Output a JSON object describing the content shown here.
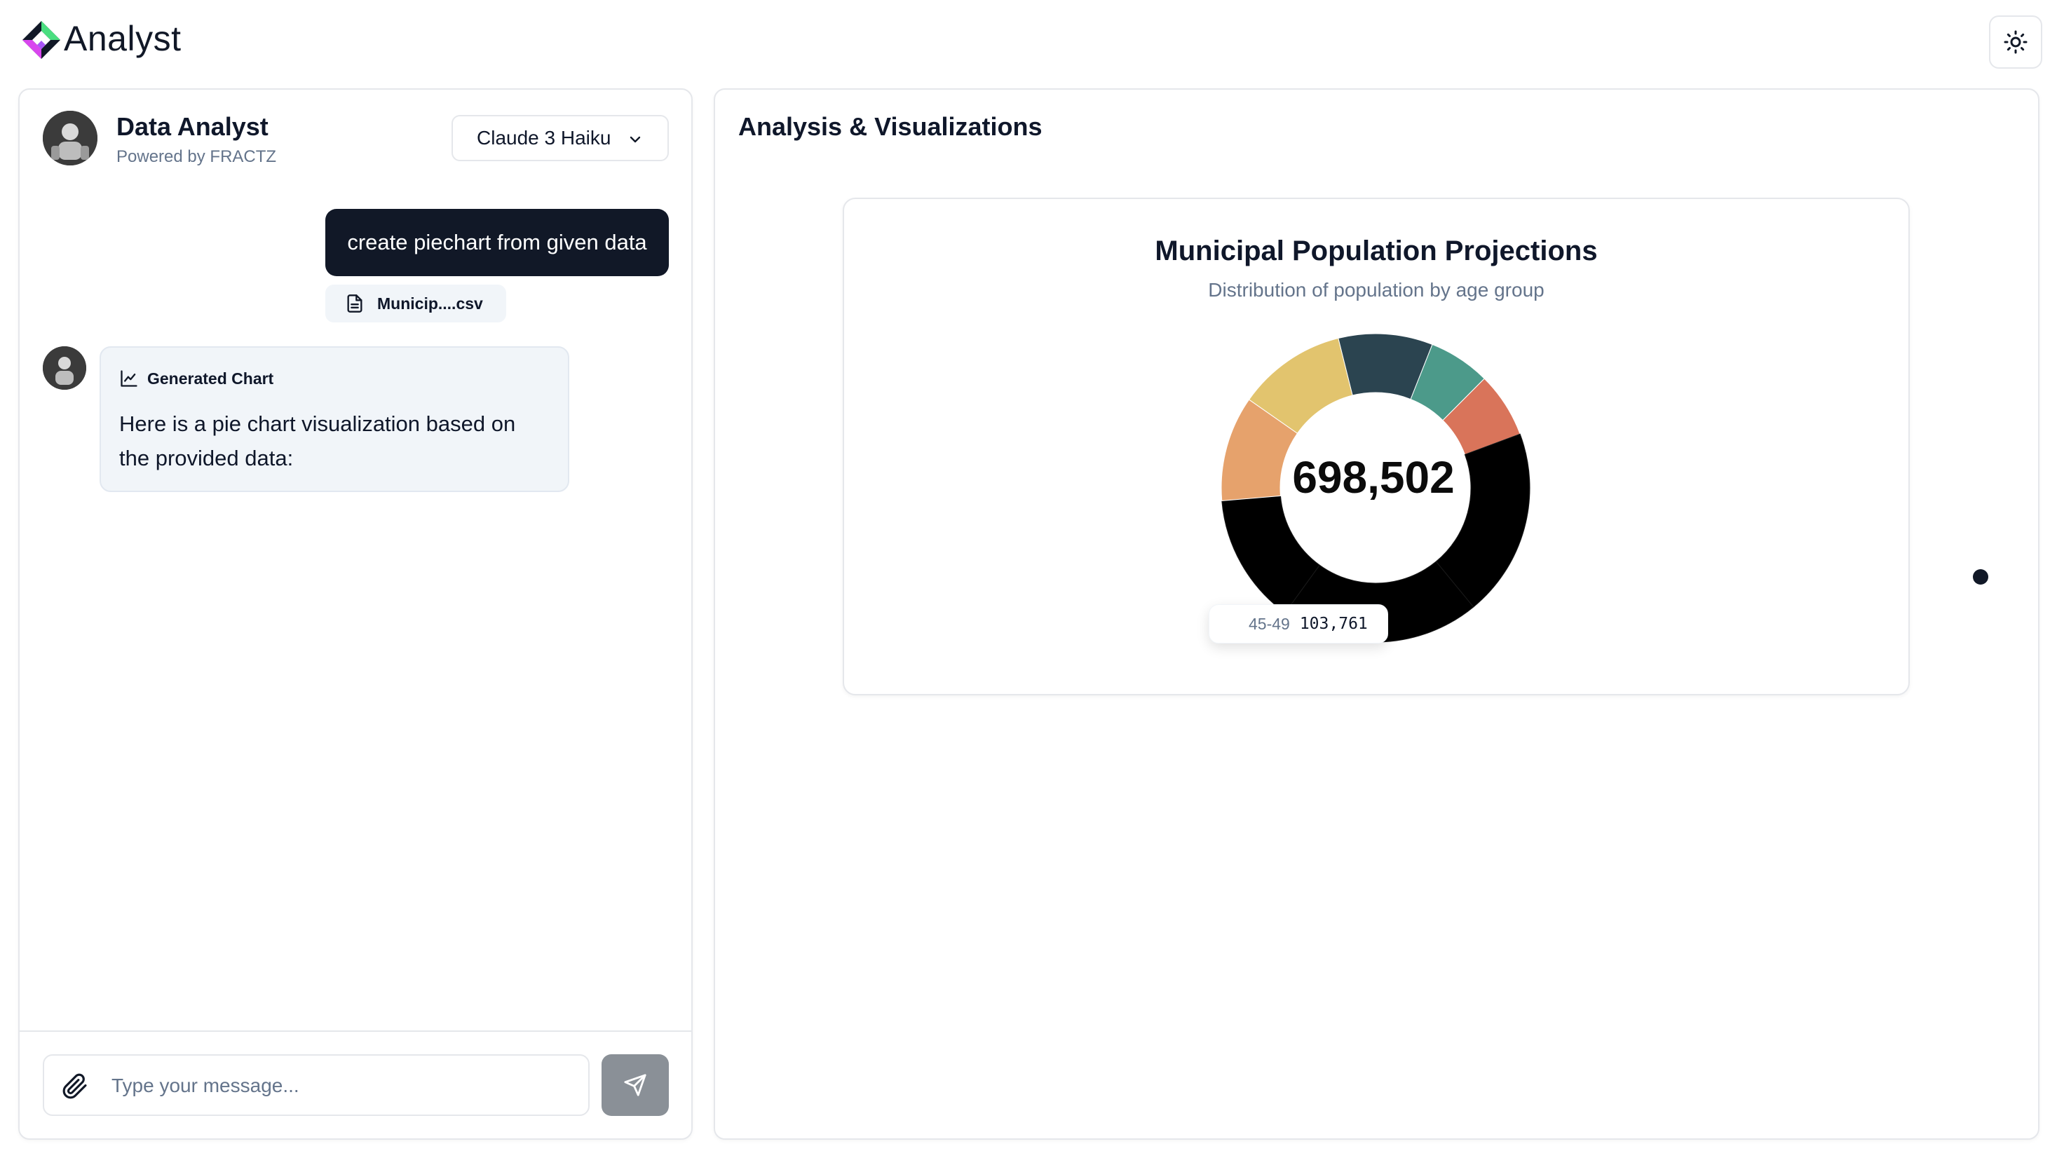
{
  "app": {
    "title": "Analyst"
  },
  "chat": {
    "agent_name": "Data Analyst",
    "agent_sub": "Powered by FRACTZ",
    "model": "Claude 3 Haiku",
    "user_message": "create piechart from given data",
    "attachment": "Municip....csv",
    "assistant_tag": "Generated Chart",
    "assistant_text": "Here is a pie chart visualization based on the provided data:",
    "input_placeholder": "Type your message..."
  },
  "viz": {
    "title": "Analysis & Visualizations"
  },
  "colors": {
    "accent": "#111827",
    "send_button": "#8a9097",
    "bubble_bg": "#f1f5f9"
  },
  "icons": {
    "logo": "diamond-logo-icon",
    "theme": "sun-icon",
    "dropdown": "chevron-down-icon",
    "file": "file-text-icon",
    "chart": "line-chart-icon",
    "attach": "paperclip-icon",
    "send": "send-icon"
  },
  "chart_data": {
    "type": "pie",
    "title": "Municipal Population Projections",
    "subtitle": "Distribution of population by age group",
    "total_label": "698,502",
    "tooltip": {
      "name": "45-49",
      "value": "103,761"
    },
    "slices": [
      {
        "value": 52000,
        "color": "#2b4450"
      },
      {
        "value": 34000,
        "color": "#4c9a8a"
      },
      {
        "value": 36000,
        "color": "#d9745a"
      },
      {
        "value": 103761,
        "color": "#000000"
      },
      {
        "value": 110000,
        "color": "#000000"
      },
      {
        "value": 72000,
        "color": "#000000"
      },
      {
        "value": 58000,
        "color": "#e6a26c"
      },
      {
        "value": 60000,
        "color": "#e2c46e"
      }
    ],
    "start_angle_deg": -14
  }
}
